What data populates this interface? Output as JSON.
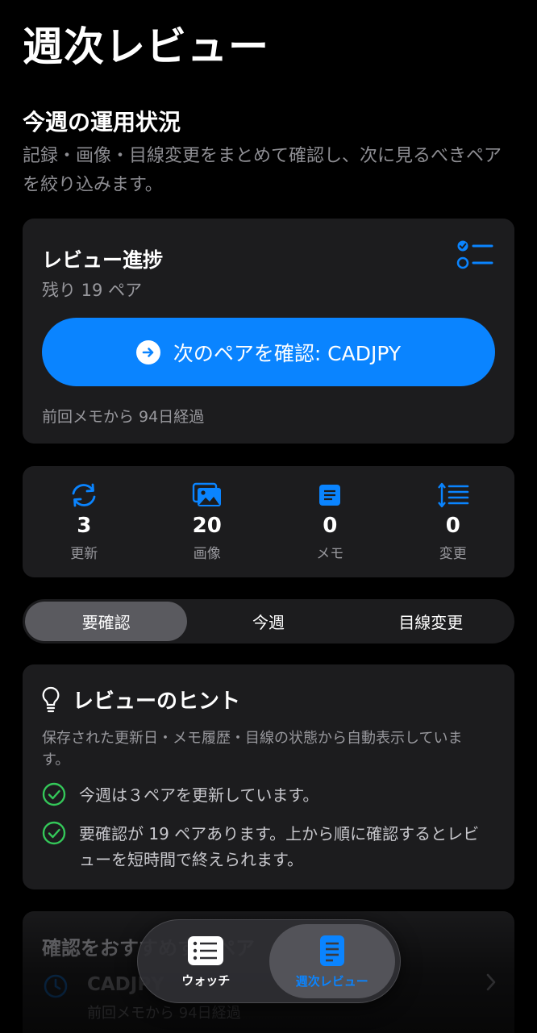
{
  "header": {
    "title": "週次レビュー"
  },
  "section": {
    "title": "今週の運用状況",
    "description": "記録・画像・目線変更をまとめて確認し、次に見るべきペアを絞り込みます。"
  },
  "progress": {
    "title": "レビュー進捗",
    "remaining": "残り 19 ペア",
    "next_button_label": "次のペアを確認: CADJPY",
    "footer": "前回メモから 94日経過"
  },
  "stats": [
    {
      "icon": "refresh-icon",
      "value": "3",
      "label": "更新"
    },
    {
      "icon": "photos-icon",
      "value": "20",
      "label": "画像"
    },
    {
      "icon": "memo-icon",
      "value": "0",
      "label": "メモ"
    },
    {
      "icon": "sort-list-icon",
      "value": "0",
      "label": "変更"
    }
  ],
  "segments": {
    "options": [
      "要確認",
      "今週",
      "目線変更"
    ],
    "selected": "要確認"
  },
  "hints": {
    "title": "レビューのヒント",
    "description": "保存された更新日・メモ履歴・目線の状態から自動表示しています。",
    "items": [
      "今週は３ペアを更新しています。",
      "要確認が 19 ペアあります。上から順に確認するとレビューを短時間で終えられます。"
    ]
  },
  "recommend": {
    "title": "確認をおすすめするペア",
    "pair": "CADJPY",
    "subtitle": "前回メモから 94日経過"
  },
  "tabbar": {
    "tabs": [
      {
        "label": "ウォッチ",
        "icon": "list-icon"
      },
      {
        "label": "週次レビュー",
        "icon": "document-icon"
      }
    ],
    "active": "週次レビュー"
  },
  "colors": {
    "accent": "#0a84ff",
    "success": "#34c759",
    "card": "#1c1c1e",
    "background": "#000000"
  }
}
